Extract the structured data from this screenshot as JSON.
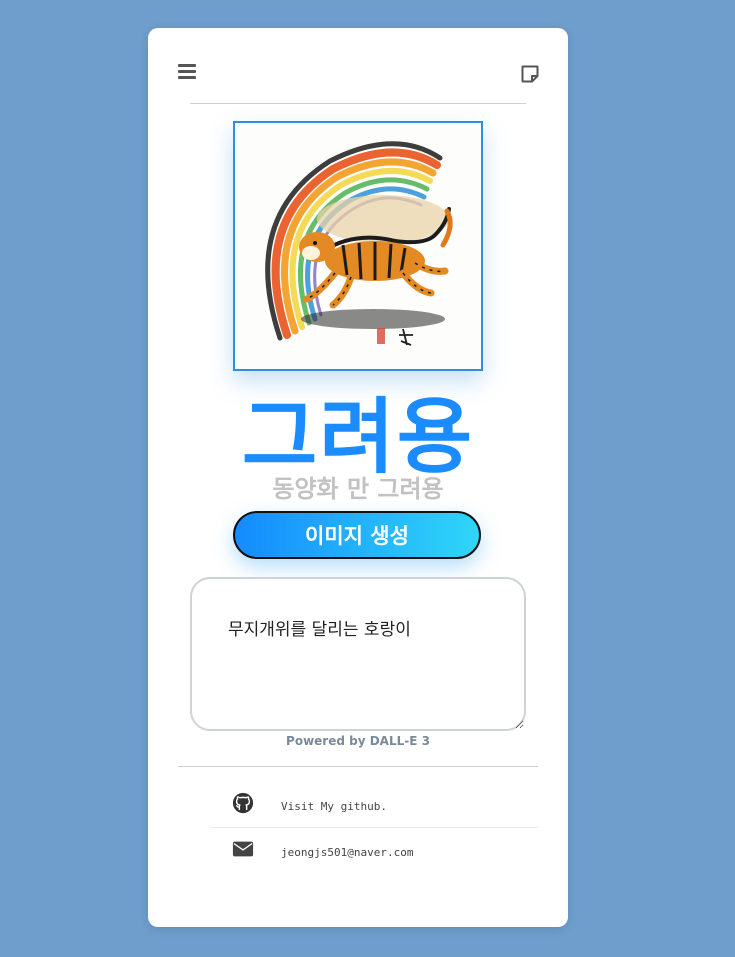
{
  "header": {
    "menu_icon": "hamburger-menu-icon",
    "note_icon": "sticky-note-icon"
  },
  "hero_image": {
    "alt": "무지개위를 달리는 호랑이"
  },
  "brand": {
    "title": "그려용",
    "subtitle": "동양화 만 그려용",
    "accent_color": "#1a8cff"
  },
  "generate_button": {
    "label": "이미지 생성"
  },
  "prompt": {
    "value": "무지개위를 달리는 호랑이"
  },
  "footer": {
    "powered_by": "Powered by DALL-E 3",
    "contacts": [
      {
        "icon": "github-icon",
        "text": "Visit My github."
      },
      {
        "icon": "envelope-icon",
        "text": "jeongjs501@naver.com"
      }
    ]
  },
  "colors": {
    "page_background": "#6f9ecd",
    "card_background": "#ffffff",
    "frame_border": "#2e8ee0"
  }
}
